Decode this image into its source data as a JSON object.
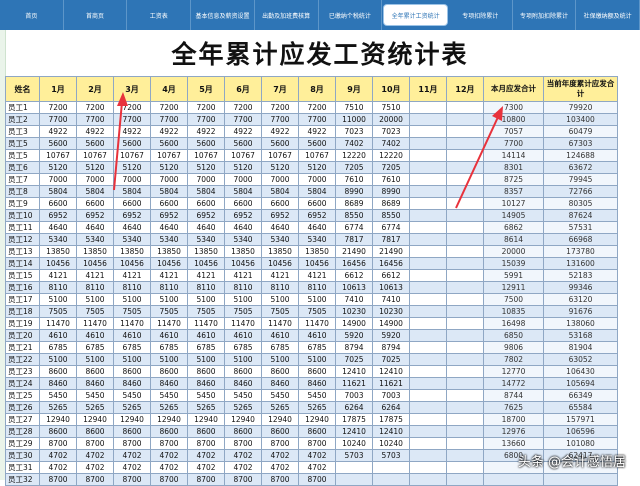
{
  "navbar": {
    "items": [
      {
        "label": "首页",
        "active": false
      },
      {
        "label": "首商页",
        "active": false
      },
      {
        "label": "工资表",
        "active": false
      },
      {
        "label": "基本信息及薪资设置",
        "active": false
      },
      {
        "label": "出勤及加班费核算",
        "active": false
      },
      {
        "label": "已缴纳个税统计",
        "active": false
      },
      {
        "label": "全年累计工资统计",
        "active": true
      },
      {
        "label": "专项扣除累计",
        "active": false
      },
      {
        "label": "专项附加扣除累计",
        "active": false
      },
      {
        "label": "社保缴纳额及统计",
        "active": false
      }
    ]
  },
  "page_title": "全年累计应发工资统计表",
  "table": {
    "headers": [
      "姓名",
      "1月",
      "2月",
      "3月",
      "4月",
      "5月",
      "6月",
      "7月",
      "8月",
      "9月",
      "10月",
      "11月",
      "12月",
      "本月应发合计",
      "当前年度累计应发合计"
    ],
    "rows": [
      [
        "员工1",
        "7200",
        "7200",
        "7200",
        "7200",
        "7200",
        "7200",
        "7200",
        "7200",
        "7510",
        "7510",
        "",
        "",
        "7300",
        "79920"
      ],
      [
        "员工2",
        "7700",
        "7700",
        "7700",
        "7700",
        "7700",
        "7700",
        "7700",
        "7700",
        "11000",
        "20000",
        "",
        "",
        "10800",
        "103400"
      ],
      [
        "员工3",
        "4922",
        "4922",
        "4922",
        "4922",
        "4922",
        "4922",
        "4922",
        "4922",
        "7023",
        "7023",
        "",
        "",
        "7057",
        "60479"
      ],
      [
        "员工5",
        "5600",
        "5600",
        "5600",
        "5600",
        "5600",
        "5600",
        "5600",
        "5600",
        "7402",
        "7402",
        "",
        "",
        "7700",
        "67303"
      ],
      [
        "员工5",
        "10767",
        "10767",
        "10767",
        "10767",
        "10767",
        "10767",
        "10767",
        "10767",
        "12220",
        "12220",
        "",
        "",
        "14114",
        "124688"
      ],
      [
        "员工6",
        "5120",
        "5120",
        "5120",
        "5120",
        "5120",
        "5120",
        "5120",
        "5120",
        "7205",
        "7205",
        "",
        "",
        "8301",
        "63672"
      ],
      [
        "员工7",
        "7000",
        "7000",
        "7000",
        "7000",
        "7000",
        "7000",
        "7000",
        "7000",
        "7610",
        "7610",
        "",
        "",
        "8725",
        "79945"
      ],
      [
        "员工8",
        "5804",
        "5804",
        "5804",
        "5804",
        "5804",
        "5804",
        "5804",
        "5804",
        "8990",
        "8990",
        "",
        "",
        "8357",
        "72766"
      ],
      [
        "员工9",
        "6600",
        "6600",
        "6600",
        "6600",
        "6600",
        "6600",
        "6600",
        "6600",
        "8689",
        "8689",
        "",
        "",
        "10127",
        "80305"
      ],
      [
        "员工10",
        "6952",
        "6952",
        "6952",
        "6952",
        "6952",
        "6952",
        "6952",
        "6952",
        "8550",
        "8550",
        "",
        "",
        "14905",
        "87624"
      ],
      [
        "员工11",
        "4640",
        "4640",
        "4640",
        "4640",
        "4640",
        "4640",
        "4640",
        "4640",
        "6774",
        "6774",
        "",
        "",
        "6862",
        "57531"
      ],
      [
        "员工12",
        "5340",
        "5340",
        "5340",
        "5340",
        "5340",
        "5340",
        "5340",
        "5340",
        "7817",
        "7817",
        "",
        "",
        "8614",
        "66968"
      ],
      [
        "员工13",
        "13850",
        "13850",
        "13850",
        "13850",
        "13850",
        "13850",
        "13850",
        "13850",
        "21490",
        "21490",
        "",
        "",
        "20000",
        "173780"
      ],
      [
        "员工14",
        "10456",
        "10456",
        "10456",
        "10456",
        "10456",
        "10456",
        "10456",
        "10456",
        "16456",
        "16456",
        "",
        "",
        "15039",
        "131600"
      ],
      [
        "员工15",
        "4121",
        "4121",
        "4121",
        "4121",
        "4121",
        "4121",
        "4121",
        "4121",
        "6612",
        "6612",
        "",
        "",
        "5991",
        "52183"
      ],
      [
        "员工16",
        "8110",
        "8110",
        "8110",
        "8110",
        "8110",
        "8110",
        "8110",
        "8110",
        "10613",
        "10613",
        "",
        "",
        "12911",
        "99346"
      ],
      [
        "员工17",
        "5100",
        "5100",
        "5100",
        "5100",
        "5100",
        "5100",
        "5100",
        "5100",
        "7410",
        "7410",
        "",
        "",
        "7500",
        "63120"
      ],
      [
        "员工18",
        "7505",
        "7505",
        "7505",
        "7505",
        "7505",
        "7505",
        "7505",
        "7505",
        "10230",
        "10230",
        "",
        "",
        "10835",
        "91676"
      ],
      [
        "员工19",
        "11470",
        "11470",
        "11470",
        "11470",
        "11470",
        "11470",
        "11470",
        "11470",
        "14900",
        "14900",
        "",
        "",
        "16498",
        "138060"
      ],
      [
        "员工20",
        "4610",
        "4610",
        "4610",
        "4610",
        "4610",
        "4610",
        "4610",
        "4610",
        "5920",
        "5920",
        "",
        "",
        "6850",
        "53168"
      ],
      [
        "员工21",
        "6785",
        "6785",
        "6785",
        "6785",
        "6785",
        "6785",
        "6785",
        "6785",
        "8794",
        "8794",
        "",
        "",
        "9806",
        "81904"
      ],
      [
        "员工22",
        "5100",
        "5100",
        "5100",
        "5100",
        "5100",
        "5100",
        "5100",
        "5100",
        "7025",
        "7025",
        "",
        "",
        "7802",
        "63052"
      ],
      [
        "员工23",
        "8600",
        "8600",
        "8600",
        "8600",
        "8600",
        "8600",
        "8600",
        "8600",
        "12410",
        "12410",
        "",
        "",
        "12770",
        "106430"
      ],
      [
        "员工24",
        "8460",
        "8460",
        "8460",
        "8460",
        "8460",
        "8460",
        "8460",
        "8460",
        "11621",
        "11621",
        "",
        "",
        "14772",
        "105694"
      ],
      [
        "员工25",
        "5450",
        "5450",
        "5450",
        "5450",
        "5450",
        "5450",
        "5450",
        "5450",
        "7003",
        "7003",
        "",
        "",
        "8744",
        "66349"
      ],
      [
        "员工26",
        "5265",
        "5265",
        "5265",
        "5265",
        "5265",
        "5265",
        "5265",
        "5265",
        "6264",
        "6264",
        "",
        "",
        "7625",
        "65584"
      ],
      [
        "员工27",
        "12940",
        "12940",
        "12940",
        "12940",
        "12940",
        "12940",
        "12940",
        "12940",
        "17875",
        "17875",
        "",
        "",
        "18700",
        "157971"
      ],
      [
        "员工28",
        "8600",
        "8600",
        "8600",
        "8600",
        "8600",
        "8600",
        "8600",
        "8600",
        "12410",
        "12410",
        "",
        "",
        "12976",
        "106596"
      ],
      [
        "员工29",
        "8700",
        "8700",
        "8700",
        "8700",
        "8700",
        "8700",
        "8700",
        "8700",
        "10240",
        "10240",
        "",
        "",
        "13660",
        "101080"
      ],
      [
        "员工30",
        "4702",
        "4702",
        "4702",
        "4702",
        "4702",
        "4702",
        "4702",
        "4702",
        "5703",
        "5703",
        "",
        "",
        "6800",
        "62417"
      ],
      [
        "员工31",
        "4702",
        "4702",
        "4702",
        "4702",
        "4702",
        "4702",
        "4702",
        "4702",
        "",
        "",
        "",
        "",
        "",
        ""
      ],
      [
        "员工32",
        "8700",
        "8700",
        "8700",
        "8700",
        "8700",
        "8700",
        "8700",
        "8700",
        "",
        "",
        "",
        "",
        "",
        ""
      ]
    ]
  },
  "watermark": "头条 @会计感悟居",
  "colors": {
    "nav_bg": "#2e75b6",
    "header_bg": "#ffef9a",
    "row_alt_bg": "#dce8f6",
    "arrow": "#e8323c"
  }
}
